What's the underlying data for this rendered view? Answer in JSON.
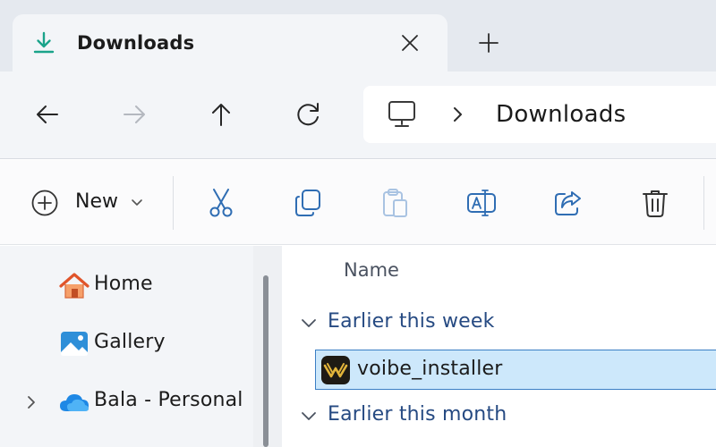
{
  "tab": {
    "title": "Downloads",
    "icon": "download-icon",
    "close_icon": "close-icon",
    "new_tab_icon": "plus-icon"
  },
  "nav": {
    "back_icon": "arrow-left-icon",
    "forward_icon": "arrow-right-icon",
    "up_icon": "arrow-up-icon",
    "refresh_icon": "refresh-icon"
  },
  "address": {
    "root_icon": "this-pc-icon",
    "separator_icon": "chevron-right-icon",
    "current": "Downloads"
  },
  "command_bar": {
    "new_label": "New",
    "new_icon": "circle-plus-icon",
    "new_dropdown_icon": "chevron-down-icon",
    "actions": [
      {
        "name": "cut",
        "icon": "scissors-icon",
        "enabled": true
      },
      {
        "name": "copy",
        "icon": "copy-icon",
        "enabled": true
      },
      {
        "name": "paste",
        "icon": "clipboard-icon",
        "enabled": false
      },
      {
        "name": "rename",
        "icon": "rename-icon",
        "enabled": true
      },
      {
        "name": "share",
        "icon": "share-icon",
        "enabled": true
      },
      {
        "name": "delete",
        "icon": "trash-icon",
        "enabled": true
      }
    ]
  },
  "sidebar": {
    "items": [
      {
        "label": "Home",
        "icon": "home-icon"
      },
      {
        "label": "Gallery",
        "icon": "gallery-icon"
      },
      {
        "label": "Bala - Personal",
        "icon": "onedrive-cloud-icon",
        "expandable": true
      }
    ]
  },
  "file_list": {
    "column_header": "Name",
    "groups": [
      {
        "label": "Earlier this week",
        "expanded": true,
        "files": [
          {
            "name": "voibe_installer",
            "icon": "voibe-app-icon",
            "selected": true
          }
        ]
      },
      {
        "label": "Earlier this month",
        "expanded": true,
        "files": []
      }
    ]
  },
  "colors": {
    "accent": "#0f6cbd",
    "selection_fill": "#cde8fb",
    "selection_border": "#3b7fc4",
    "group_label": "#264a82",
    "download_icon": "#1aa38a",
    "app_icon_bg": "#1e1b14",
    "app_icon_gold": "#e2b53a"
  }
}
